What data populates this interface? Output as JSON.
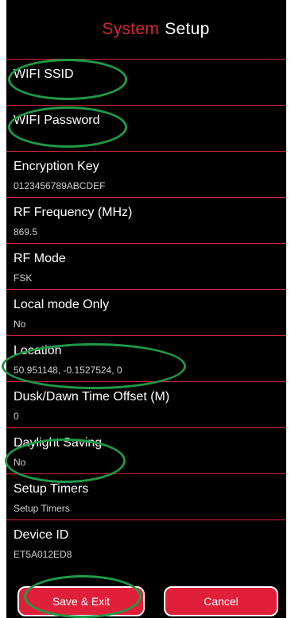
{
  "header": {
    "title_part1": "System",
    "title_part2": "Setup"
  },
  "settings": [
    {
      "label": "WIFI SSID",
      "value": ""
    },
    {
      "label": "WIFI Password",
      "value": ""
    },
    {
      "label": "Encryption Key",
      "value": "0123456789ABCDEF"
    },
    {
      "label": "RF Frequency (MHz)",
      "value": "869.5"
    },
    {
      "label": "RF Mode",
      "value": "FSK"
    },
    {
      "label": "Local mode Only",
      "value": "No"
    },
    {
      "label": "Location",
      "value": "50.951148, -0.1527524, 0"
    },
    {
      "label": "Dusk/Dawn Time Offset (M)",
      "value": "0"
    },
    {
      "label": "Daylight Saving",
      "value": "No"
    },
    {
      "label": "Setup Timers",
      "value": "Setup Timers"
    },
    {
      "label": "Device ID",
      "value": "ET5A012ED8"
    }
  ],
  "actions": {
    "save_label": "Save & Exit",
    "cancel_label": "Cancel"
  },
  "colors": {
    "accent": "#d6253a",
    "button": "#e0203a",
    "highlight": "#1f9a47",
    "background": "#000000"
  }
}
